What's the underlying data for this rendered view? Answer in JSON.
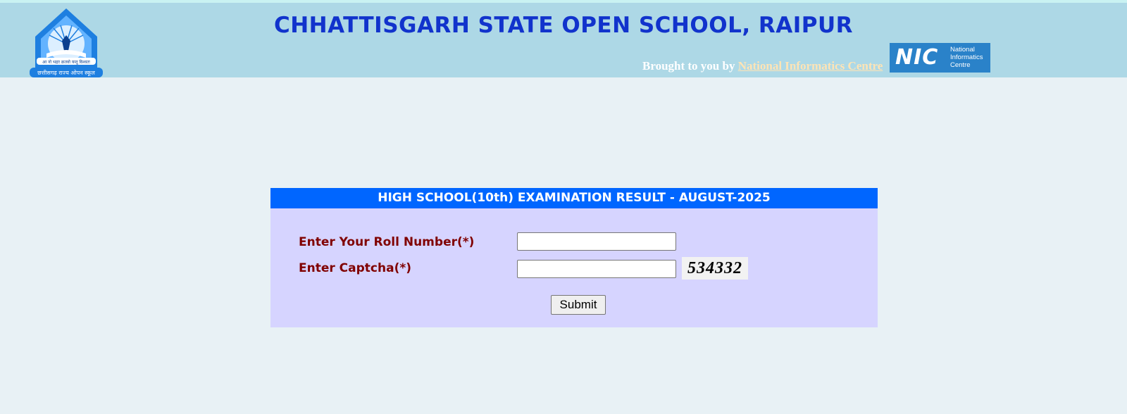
{
  "header": {
    "title": "CHHATTISGARH STATE OPEN SCHOOL, RAIPUR",
    "logo_text_top": "आ नो भद्राः क्रतवो यन्तु विश्वतः",
    "logo_text_bottom": "छत्तीसगढ़ राज्य ओपन स्कूल",
    "credit_prefix": "Brought to you by",
    "credit_link": "National Informatics Centre",
    "nic_logo_big": "NIC",
    "nic_logo_small_1": "National",
    "nic_logo_small_2": "Informatics",
    "nic_logo_small_3": "Centre"
  },
  "form": {
    "title": "HIGH SCHOOL(10th) EXAMINATION RESULT - AUGUST-2025",
    "roll_label": "Enter Your Roll Number(*)",
    "roll_value": "",
    "captcha_label": "Enter Captcha(*)",
    "captcha_value": "",
    "captcha_code": "534332",
    "submit_label": "Submit"
  },
  "colors": {
    "header_bg": "#add8e6",
    "title_color": "#1133cc",
    "panel_title_bg": "#0066ff",
    "panel_bg": "#d6d4ff",
    "label_color": "#800000",
    "page_bg": "#e8f1f5"
  }
}
